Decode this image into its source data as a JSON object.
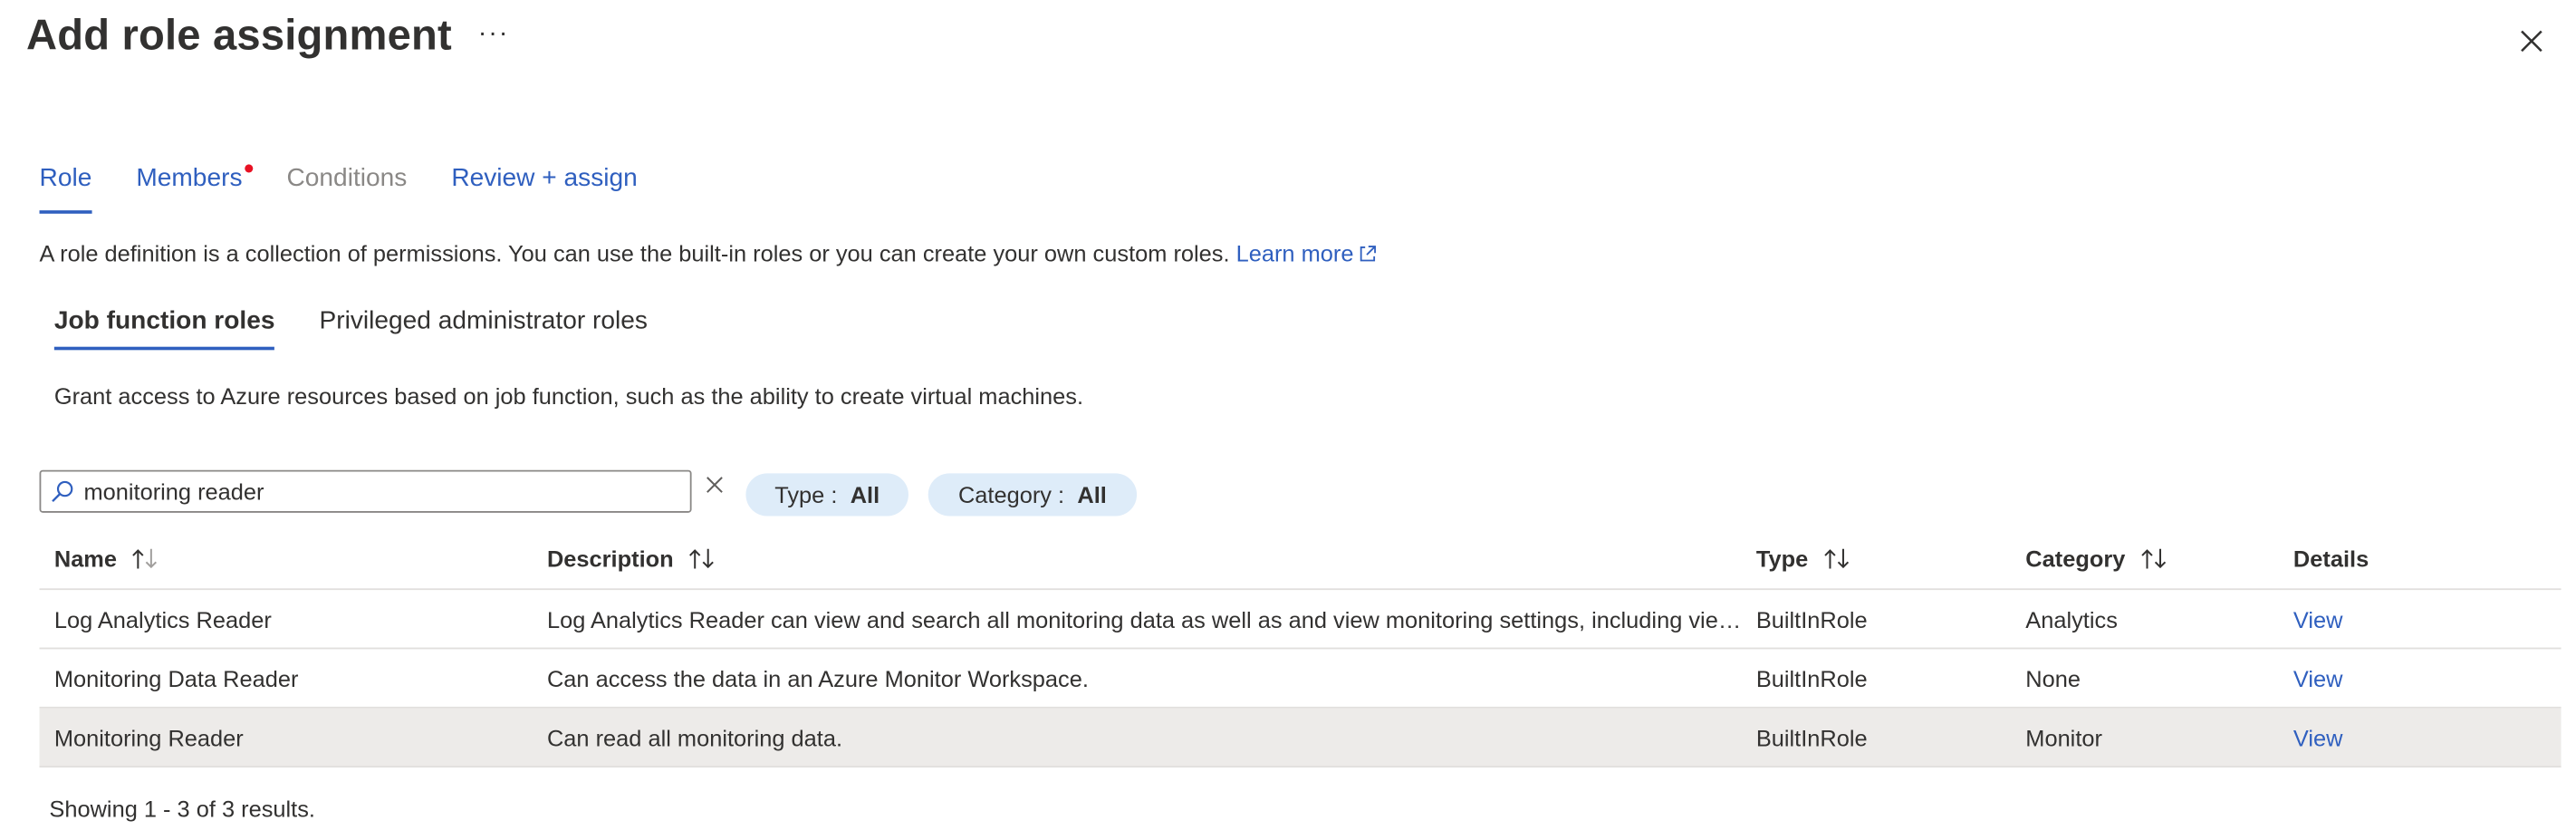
{
  "header": {
    "title": "Add role assignment",
    "more_label": "···"
  },
  "tabs": [
    {
      "label": "Role",
      "state": "active"
    },
    {
      "label": "Members",
      "state": "normal",
      "has_indicator": true
    },
    {
      "label": "Conditions",
      "state": "disabled"
    },
    {
      "label": "Review + assign",
      "state": "normal"
    }
  ],
  "intro": {
    "text": "A role definition is a collection of permissions. You can use the built-in roles or you can create your own custom roles. ",
    "link_label": "Learn more"
  },
  "subtabs": [
    {
      "label": "Job function roles",
      "state": "active"
    },
    {
      "label": "Privileged administrator roles",
      "state": "normal"
    }
  ],
  "subtab_description": "Grant access to Azure resources based on job function, such as the ability to create virtual machines.",
  "search": {
    "value": "monitoring reader"
  },
  "filters": {
    "type": {
      "label": "Type : ",
      "value": "All"
    },
    "category": {
      "label": "Category : ",
      "value": "All"
    }
  },
  "table": {
    "columns": [
      "Name",
      "Description",
      "Type",
      "Category",
      "Details"
    ],
    "rows": [
      {
        "name": "Log Analytics Reader",
        "description": "Log Analytics Reader can view and search all monitoring data as well as and view monitoring settings, including viewing the configuration of Azure diagnostics on all Azure resources.",
        "type": "BuiltInRole",
        "category": "Analytics",
        "details": "View"
      },
      {
        "name": "Monitoring Data Reader",
        "description": "Can access the data in an Azure Monitor Workspace.",
        "type": "BuiltInRole",
        "category": "None",
        "details": "View"
      },
      {
        "name": "Monitoring Reader",
        "description": "Can read all monitoring data.",
        "type": "BuiltInRole",
        "category": "Monitor",
        "details": "View",
        "selected": true
      }
    ]
  },
  "footer": {
    "count_text": "Showing 1 - 3 of 3 results."
  },
  "colors": {
    "accent": "#2f5fbf",
    "indicator": "#e81123",
    "pill_bg": "#deecf9",
    "selected_row": "#edebe9"
  }
}
